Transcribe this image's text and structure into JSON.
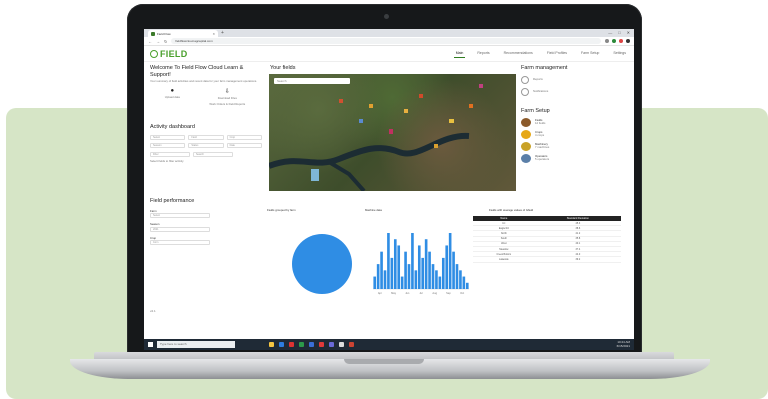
{
  "browser": {
    "tab_title": "Field Flow",
    "new_tab": "+",
    "url": "fieldflowcloud.agcapital.com",
    "window_controls": [
      "—",
      "□",
      "✕"
    ]
  },
  "app": {
    "logo": "FIELD",
    "nav_tabs": [
      "Main",
      "Reports",
      "Recommendations",
      "Field Profiles",
      "Farm Setup",
      "Settings"
    ],
    "active_tab": "Main"
  },
  "welcome": {
    "title": "Welcome To Field Flow Cloud Learn & Support!",
    "subtitle": "Your summary of field activities and recent data for your farm management operations.",
    "quick_actions": [
      {
        "icon": "upload-icon",
        "glyph": "●",
        "label": "Upload data"
      },
      {
        "icon": "download-icon",
        "glyph": "⇩",
        "label": "Download Files"
      }
    ],
    "quick_subs": [
      "",
      "Work Orders & Field Reports"
    ]
  },
  "activity": {
    "title": "Activity dashboard",
    "fields": [
      "Select",
      "Field",
      "Crop",
      "Season",
      "Status",
      "Date"
    ],
    "filter_labels": [
      "Filter",
      "Search"
    ],
    "note": "Select fields to filter activity"
  },
  "fields_map": {
    "title": "Your fields",
    "search_placeholder": "Search"
  },
  "farm_management": {
    "title": "Farm management",
    "options": [
      "Reports",
      "Notifications"
    ]
  },
  "farm_setup": {
    "title": "Farm Setup",
    "items": [
      {
        "name": "Fields",
        "sub": "12 fields",
        "color": "#8b5a2b"
      },
      {
        "name": "Crops",
        "sub": "4 crops",
        "color": "#e6a817"
      },
      {
        "name": "Machinery",
        "sub": "7 machines",
        "color": "#c9a227"
      },
      {
        "name": "Operators",
        "sub": "5 operators",
        "color": "#5b7fa8"
      }
    ]
  },
  "field_performance": {
    "title": "Field performance",
    "labels": [
      "Farm",
      "Season",
      "Crop"
    ],
    "values": [
      "Select",
      "2021",
      "Corn"
    ]
  },
  "charts": {
    "pie_title": "Fields grouped by farm",
    "bar_title": "Machine data",
    "table_title": "Fields with average values of Gfield",
    "pie_color": "#2f8de4",
    "bar_color": "#2f8de4"
  },
  "chart_data": [
    {
      "type": "pie",
      "title": "Fields grouped by farm",
      "labels": [
        ""
      ],
      "values": [
        100
      ]
    },
    {
      "type": "bar",
      "title": "Machine data",
      "categories": [
        "Apr",
        "May",
        "Jun",
        "Jul",
        "Aug",
        "Sep",
        "Oct"
      ],
      "values": [
        2,
        4,
        6,
        3,
        9,
        5,
        8,
        7,
        2,
        6,
        4,
        9,
        3,
        7,
        5,
        8,
        6,
        4,
        3,
        2,
        5,
        7,
        9,
        6,
        4,
        3,
        2,
        1
      ],
      "xlabel": "",
      "ylabel": ""
    },
    {
      "type": "table",
      "title": "Fields with average values of Gfield",
      "columns": [
        "Name",
        "Standard Deviation"
      ],
      "rows": [
        [
          "1C",
          "45.3"
        ],
        [
          "Eagle Rd",
          "38.6"
        ],
        [
          "North",
          "41.2"
        ],
        [
          "South",
          "35.8"
        ],
        [
          "West",
          "40.1"
        ],
        [
          "Meadow",
          "37.4"
        ],
        [
          "Creek Bottom",
          "44.0"
        ],
        [
          "Lakeside",
          "39.2"
        ]
      ]
    }
  ],
  "version": "v2.1",
  "taskbar": {
    "search_placeholder": "Type here to search",
    "time": "10:24 AM",
    "date": "6/15/2021"
  }
}
